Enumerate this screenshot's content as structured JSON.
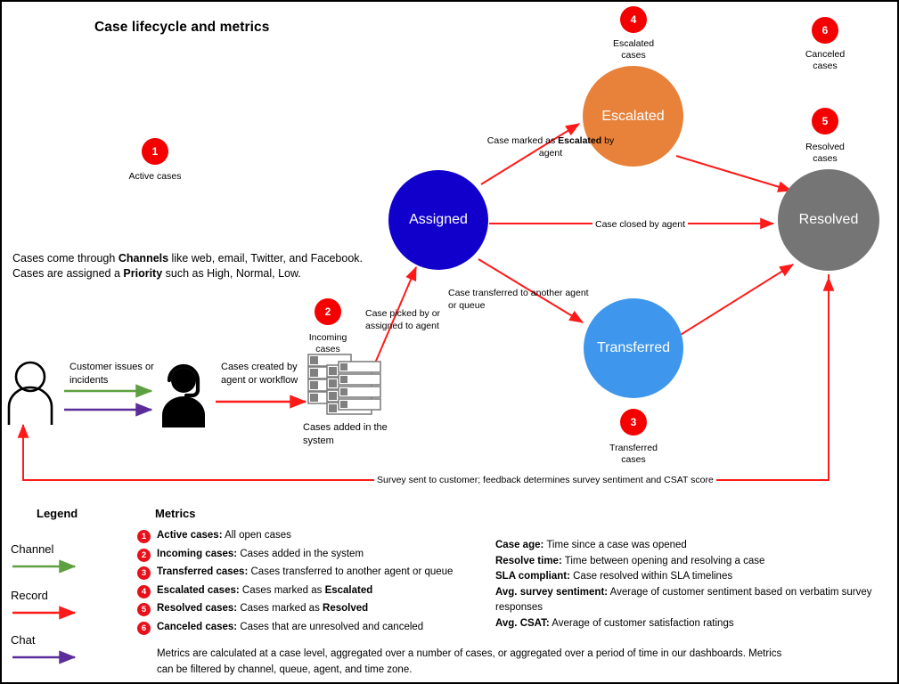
{
  "title": "Case lifecycle and metrics",
  "colors": {
    "assigned": "#1100cc",
    "escalated": "#e8823a",
    "transferred": "#3e97ec",
    "resolved": "#757575",
    "marker_red": "#f40000",
    "record_arrow": "#ff1a1a",
    "channel_arrow": "#5ca040",
    "chat_arrow": "#5b2d9b"
  },
  "intro": {
    "line1_a": "Cases come through ",
    "line1_b": "Channels",
    "line1_c": " like web, email, Twitter, and Facebook.",
    "line2_a": "Cases are assigned a ",
    "line2_b": "Priority",
    "line2_c": " such as High, Normal, Low."
  },
  "nodes": {
    "assigned": "Assigned",
    "escalated": "Escalated",
    "transferred": "Transferred",
    "resolved": "Resolved"
  },
  "markers": {
    "active": {
      "number": "1",
      "caption_line1": "Active cases",
      "caption_line2": ""
    },
    "incoming": {
      "number": "2",
      "caption_line1": "Incoming",
      "caption_line2": "cases"
    },
    "transferred": {
      "number": "3",
      "caption_line1": "Transferred",
      "caption_line2": "cases"
    },
    "escalated": {
      "number": "4",
      "caption_line1": "Escalated",
      "caption_line2": "cases"
    },
    "resolved": {
      "number": "5",
      "caption_line1": "Resolved",
      "caption_line2": "cases"
    },
    "canceled": {
      "number": "6",
      "caption_line1": "Canceled",
      "caption_line2": "cases"
    }
  },
  "edges": {
    "escalated_a": "Case marked as ",
    "escalated_b": "Escalated",
    "escalated_c": " by",
    "escalated_d": "agent",
    "closed": "Case closed by agent",
    "transferred_line1": "Case transferred to another agent",
    "transferred_line2": "or queue",
    "picked_line1": "Case picked by or",
    "picked_line2": "assigned to agent",
    "survey": "Survey sent to customer; feedback determines survey sentiment and CSAT score"
  },
  "flow": {
    "customer_issues_line1": "Customer issues or",
    "customer_issues_line2": "incidents",
    "cases_created_line1": "Cases created by",
    "cases_created_line2": "agent or workflow",
    "cases_added_line1": "Cases added in the",
    "cases_added_line2": "system"
  },
  "legend": {
    "title": "Legend",
    "items": [
      {
        "label": "Channel",
        "color": "#5ca040",
        "icon": "arrow-right-icon"
      },
      {
        "label": "Record",
        "color": "#ff1a1a",
        "icon": "arrow-right-icon"
      },
      {
        "label": "Chat",
        "color": "#5b2d9b",
        "icon": "arrow-right-icon"
      }
    ]
  },
  "metrics": {
    "title": "Metrics",
    "items": [
      {
        "number": "1",
        "term": "Active cases:",
        "desc": " All open cases",
        "desc_bold": ""
      },
      {
        "number": "2",
        "term": "Incoming cases:",
        "desc": " Cases added in the system",
        "desc_bold": ""
      },
      {
        "number": "3",
        "term": "Transferred cases:",
        "desc": " Cases transferred to another agent or queue",
        "desc_bold": ""
      },
      {
        "number": "4",
        "term": "Escalated cases:",
        "desc": " Cases marked as ",
        "desc_bold": "Escalated"
      },
      {
        "number": "5",
        "term": "Resolved cases:",
        "desc": " Cases marked as ",
        "desc_bold": "Resolved"
      },
      {
        "number": "6",
        "term": "Canceled cases:",
        "desc": " Cases that are unresolved and canceled",
        "desc_bold": ""
      }
    ],
    "note_line1": "Metrics are calculated at a case level, aggregated over a number of cases, or aggregated over a period of time in our dashboards. Metrics",
    "note_line2": "can be filtered by channel, queue, agent, and time zone."
  },
  "definitions": [
    {
      "term": "Case age:",
      "desc": " Time since a case was opened"
    },
    {
      "term": "Resolve time:",
      "desc": " Time between opening and resolving a case"
    },
    {
      "term": "SLA compliant:",
      "desc": " Case resolved within SLA timelines"
    },
    {
      "term": "Avg. survey sentiment:",
      "desc": " Average of customer sentiment based on verbatim survey"
    },
    {
      "term": "",
      "desc": "responses"
    },
    {
      "term": "Avg. CSAT:",
      "desc": " Average of customer satisfaction ratings"
    }
  ]
}
